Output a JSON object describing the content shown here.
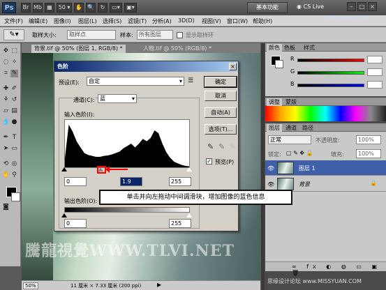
{
  "app": {
    "logo": "Ps",
    "workspace_button": "基本功能",
    "cs_live": "CS Live",
    "window_controls": [
      "–",
      "□",
      "×"
    ],
    "top_watermark": "BBS.16XX8.COM"
  },
  "menu": [
    "文件(F)",
    "编辑(E)",
    "图像(I)",
    "图层(L)",
    "选择(S)",
    "滤镜(T)",
    "分析(A)",
    "3D(D)",
    "视图(V)",
    "窗口(W)",
    "帮助(H)"
  ],
  "options_bar": {
    "sample_size_label": "取样大小:",
    "sample_size_value": "取样点",
    "sample_label": "样本:",
    "sample_value": "所有图层",
    "show_ring_label": "显示取样环"
  },
  "documents": {
    "tabs": [
      "背景.tif @ 50% (图层 1, RGB/8) *",
      "人物.tif @ 50% (RGB/8) *"
    ],
    "zoom": "50%",
    "doc_size": "11 厘米 × 7.33 厘米 (200 ppi)"
  },
  "panels": {
    "color_tabs": [
      "颜色",
      "色板",
      "样式"
    ],
    "rgb_labels": [
      "R",
      "G",
      "B"
    ],
    "rgb_values": [
      "",
      "",
      ""
    ],
    "adjust_tabs": [
      "调整",
      "蒙版"
    ],
    "layers_tabs": [
      "图层",
      "通道",
      "路径"
    ],
    "blend_mode": "正常",
    "opacity_label": "不透明度:",
    "opacity_value": "100%",
    "lock_label": "锁定:",
    "fill_label": "填充:",
    "fill_value": "100%",
    "layers": [
      {
        "name": "图层 1",
        "selected": true
      },
      {
        "name": "背景",
        "selected": false
      }
    ],
    "bottom_watermark": "思缘设计论坛 www.MISSYUAN.COM"
  },
  "dialog": {
    "title": "色阶",
    "close": "×",
    "preset_label": "预设(E):",
    "preset_value": "自定",
    "channel_label": "通道(C):",
    "channel_value": "蓝",
    "input_levels_label": "输入色阶(I):",
    "input_values": [
      "0",
      "1.9",
      "255"
    ],
    "output_levels_label": "输出色阶(O):",
    "output_values": [
      "0",
      "255"
    ],
    "buttons": [
      "确定",
      "取消",
      "自动(A)",
      "选项(T)..."
    ],
    "preview_label": "预览(P)",
    "preview_checked": true
  },
  "callout_text": "单击并向左拖动中间调滑块，增加图像的蓝色信息",
  "watermark_text": "騰龍視覺WWW.TLVI.NET",
  "chart_data": {
    "type": "area",
    "title": "",
    "x": [
      0,
      8,
      16,
      24,
      32,
      40,
      48,
      56,
      64,
      72,
      80,
      88,
      96,
      104,
      112,
      120,
      128,
      136,
      144,
      152,
      160,
      168,
      176,
      184,
      192,
      200,
      208,
      216,
      224,
      232,
      240,
      248,
      255
    ],
    "values": [
      0.2,
      0.9,
      0.75,
      0.55,
      0.42,
      0.3,
      0.26,
      0.24,
      0.22,
      0.22,
      0.24,
      0.25,
      0.27,
      0.3,
      0.33,
      0.4,
      0.45,
      0.5,
      0.42,
      0.5,
      0.6,
      0.55,
      0.62,
      0.78,
      0.72,
      0.5,
      0.32,
      0.2,
      0.12,
      0.08,
      0.05,
      0.03,
      0.02
    ],
    "xlim": [
      0,
      255
    ],
    "ylim": [
      0,
      1
    ]
  }
}
